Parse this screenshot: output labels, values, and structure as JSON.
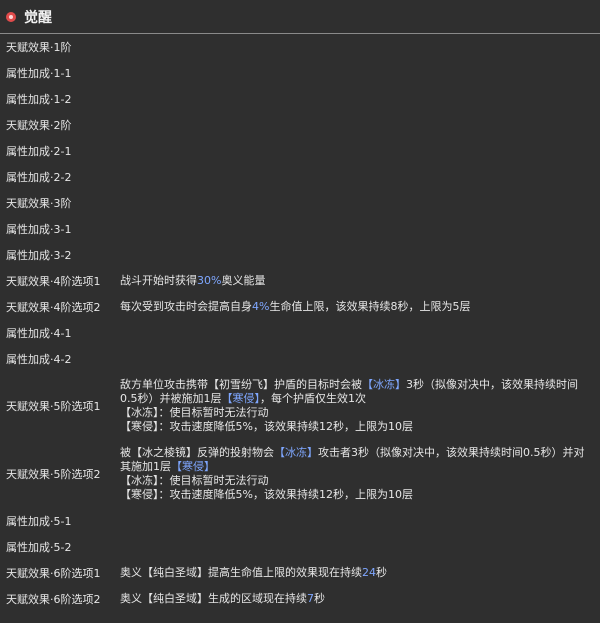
{
  "header": {
    "title": "觉醒",
    "icon": "awakening-icon"
  },
  "rows": [
    {
      "key": "天赋效果·1阶"
    },
    {
      "key": "属性加成·1-1"
    },
    {
      "key": "属性加成·1-2"
    },
    {
      "key": "天赋效果·2阶"
    },
    {
      "key": "属性加成·2-1"
    },
    {
      "key": "属性加成·2-2"
    },
    {
      "key": "天赋效果·3阶"
    },
    {
      "key": "属性加成·3-1"
    },
    {
      "key": "属性加成·3-2"
    },
    {
      "key": "天赋效果·4阶选项1",
      "desc": {
        "a": "战斗开始时获得",
        "hl": "30%",
        "b": "奥义能量"
      }
    },
    {
      "key": "天赋效果·4阶选项2",
      "desc": {
        "a": "每次受到攻击时会提高自身",
        "hl": "4%",
        "b": "生命值上限，该效果持续8秒，上限为5层"
      }
    },
    {
      "key": "属性加成·4-1"
    },
    {
      "key": "属性加成·4-2"
    },
    {
      "key": "天赋效果·5阶选项1",
      "lines": [
        {
          "a": "敌方单位攻击携带【初雪纷飞】护盾的目标时会被",
          "hl": "【冰冻】",
          "b": "3秒（拟像对决中，该效果持续时间"
        },
        {
          "a": "0.5秒）并被施加1层",
          "hl": "【寒侵】",
          "b": "，每个护盾仅生效1次"
        },
        {
          "a": "【冰冻】：使目标暂时无法行动"
        },
        {
          "a": "【寒侵】：攻击速度降低5%，该效果持续12秒，上限为10层"
        }
      ]
    },
    {
      "key": "天赋效果·5阶选项2",
      "lines": [
        {
          "a": "被【冰之棱镜】反弹的投射物会",
          "hl": "【冰冻】",
          "b": "攻击者3秒（拟像对决中，该效果持续时间0.5秒）并对"
        },
        {
          "a": "其施加1层",
          "hl": "【寒侵】"
        },
        {
          "a": "【冰冻】：使目标暂时无法行动"
        },
        {
          "a": "【寒侵】：攻击速度降低5%，该效果持续12秒，上限为10层"
        }
      ]
    },
    {
      "key": "属性加成·5-1"
    },
    {
      "key": "属性加成·5-2"
    },
    {
      "key": "天赋效果·6阶选项1",
      "desc": {
        "a": "奥义【纯白圣域】提高生命值上限的效果现在持续",
        "hl": "24",
        "b": "秒"
      }
    },
    {
      "key": "天赋效果·6阶选项2",
      "desc": {
        "a": "奥义【纯白圣域】生成的区域现在持续",
        "hl": "7",
        "b": "秒"
      }
    }
  ]
}
